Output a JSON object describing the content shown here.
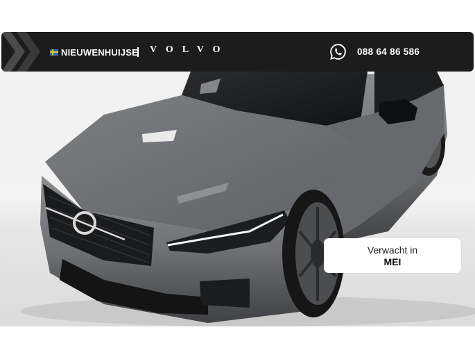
{
  "header": {
    "dealer_name": "NIEUWENHUIJSE",
    "brand": "VOLVO",
    "phone": "088 64 86 586",
    "icons": [
      "swedish-flag-icon",
      "whatsapp-icon"
    ]
  },
  "badge": {
    "label": "Verwacht in",
    "month": "MEI"
  },
  "colors": {
    "banner_bg": "#1c1c1c",
    "car_paint": "#6b6e72",
    "text_light": "#ffffff"
  }
}
